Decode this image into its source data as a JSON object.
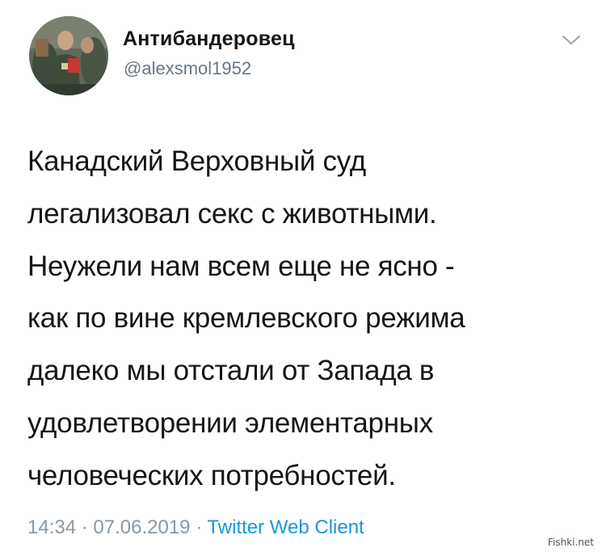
{
  "tweet": {
    "author": {
      "display_name": "Антибандеровец",
      "handle": "@alexsmol1952",
      "avatar": "avatar-photo"
    },
    "menu_icon": "chevron-down-icon",
    "text": "Канадский Верховный суд\nлегализовал секс с животными.\nНеужели нам всем  еще не ясно -\nкак по вине кремлевского режима\nдалеко мы отстали от  Запада в\nудовлетворении элементарных\nчеловеческих потребностей.",
    "time": "14:34",
    "separator": "·",
    "date": "07.06.2019",
    "client": "Twitter Web Client"
  },
  "watermark": "Fishki.net",
  "colors": {
    "text": "#14171a",
    "secondary": "#657786",
    "link": "#1b95e0"
  }
}
